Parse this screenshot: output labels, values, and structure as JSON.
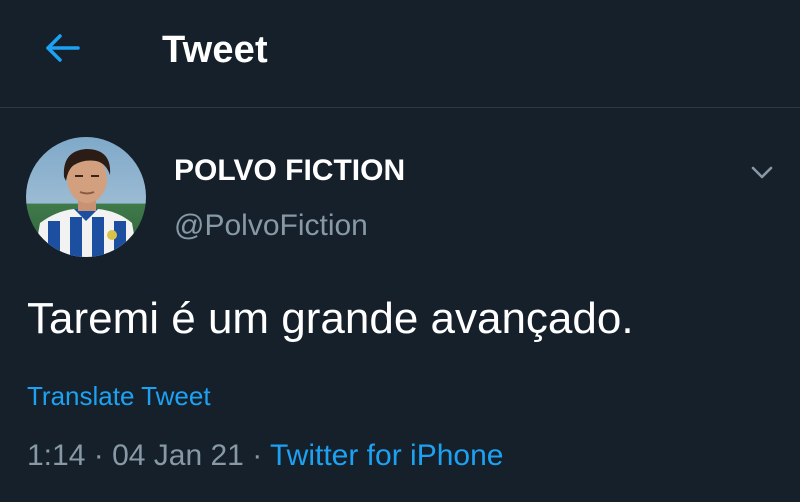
{
  "header": {
    "title": "Tweet",
    "back_icon": "arrow-left-icon",
    "accent_color": "#1da1f2"
  },
  "tweet": {
    "author": {
      "display_name": "POLVO FICTION",
      "handle": "@PolvoFiction"
    },
    "more_icon": "chevron-down-icon",
    "text": "Taremi é um grande avançado.",
    "translate_label": "Translate Tweet",
    "time": "1:14",
    "separator": "·",
    "date": "04 Jan 21",
    "source": "Twitter for iPhone"
  },
  "colors": {
    "background": "#15202b",
    "secondary_text": "#8899a6",
    "link": "#1da1f2",
    "divider": "#2b3a48"
  }
}
